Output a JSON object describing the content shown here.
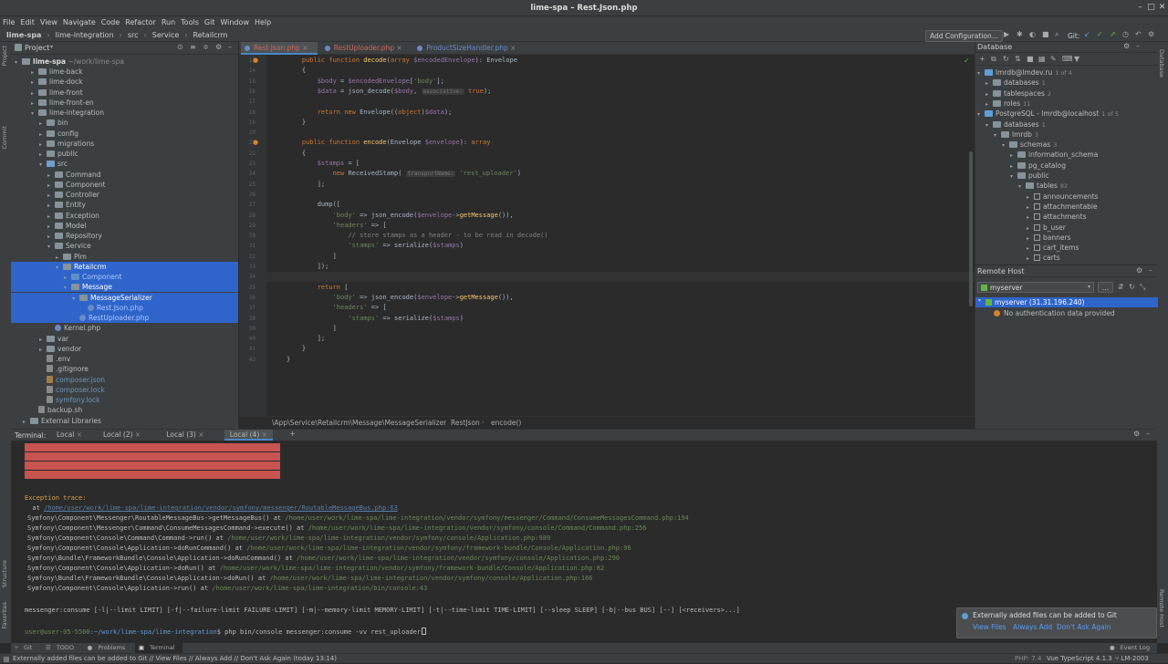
{
  "window": {
    "title": "lime-spa – Rest.Json.php"
  },
  "menu": [
    "File",
    "Edit",
    "View",
    "Navigate",
    "Code",
    "Refactor",
    "Run",
    "Tools",
    "Git",
    "Window",
    "Help"
  ],
  "breadcrumb": [
    "lime-spa",
    "lime-integration",
    "src",
    "Service",
    "Retailcrm"
  ],
  "toolbar": {
    "add_config": "Add Configuration...",
    "git_label": "Git:"
  },
  "side_tabs": {
    "project": "Project",
    "commit": "Commit",
    "structure": "Structure",
    "favorites": "Favorites",
    "database": "Database",
    "remote": "Remote Host"
  },
  "project": {
    "header": "Project",
    "root_name": "lime-spa",
    "root_path": "~/work/lime-spa",
    "items": [
      {
        "label": "lime-back",
        "d": 2,
        "t": "folder"
      },
      {
        "label": "lime-dock",
        "d": 2,
        "t": "folder"
      },
      {
        "label": "lime-front",
        "d": 2,
        "t": "folder"
      },
      {
        "label": "lime-front-en",
        "d": 2,
        "t": "folder"
      },
      {
        "label": "lime-integration",
        "d": 2,
        "t": "folder",
        "open": true
      },
      {
        "label": "bin",
        "d": 3,
        "t": "folder"
      },
      {
        "label": "config",
        "d": 3,
        "t": "folder"
      },
      {
        "label": "migrations",
        "d": 3,
        "t": "folder"
      },
      {
        "label": "public",
        "d": 3,
        "t": "folder"
      },
      {
        "label": "src",
        "d": 3,
        "t": "src",
        "open": true
      },
      {
        "label": "Command",
        "d": 4,
        "t": "folder"
      },
      {
        "label": "Component",
        "d": 4,
        "t": "folder"
      },
      {
        "label": "Controller",
        "d": 4,
        "t": "folder"
      },
      {
        "label": "Entity",
        "d": 4,
        "t": "folder"
      },
      {
        "label": "Exception",
        "d": 4,
        "t": "folder"
      },
      {
        "label": "Model",
        "d": 4,
        "t": "folder"
      },
      {
        "label": "Repository",
        "d": 4,
        "t": "folder"
      },
      {
        "label": "Service",
        "d": 4,
        "t": "folder",
        "open": true
      },
      {
        "label": "Plm",
        "d": 5,
        "t": "folder"
      },
      {
        "label": "Retailcrm",
        "d": 5,
        "t": "folder",
        "open": true,
        "sel": true
      },
      {
        "label": "Component",
        "d": 6,
        "t": "folder",
        "sel": true,
        "blue": true
      },
      {
        "label": "Message",
        "d": 6,
        "t": "folder",
        "open": true,
        "sel": true
      },
      {
        "label": "MessageSerializer",
        "d": 7,
        "t": "folder",
        "open": true,
        "sel": true
      },
      {
        "label": "Rest.Json.php",
        "d": 8,
        "t": "php",
        "sel": true,
        "blue": true
      },
      {
        "label": "RestUploader.php",
        "d": 7,
        "t": "php",
        "sel": true,
        "blue": true
      },
      {
        "label": "Kernel.php",
        "d": 4,
        "t": "php"
      },
      {
        "label": "var",
        "d": 3,
        "t": "folder"
      },
      {
        "label": "vendor",
        "d": 3,
        "t": "folder"
      },
      {
        "label": ".env",
        "d": 3,
        "t": "txt"
      },
      {
        "label": ".gitignore",
        "d": 3,
        "t": "txt"
      },
      {
        "label": "composer.json",
        "d": 3,
        "t": "json",
        "blue": true
      },
      {
        "label": "composer.lock",
        "d": 3,
        "t": "txt",
        "blue": true
      },
      {
        "label": "symfony.lock",
        "d": 3,
        "t": "txt",
        "blue": true
      },
      {
        "label": "backup.sh",
        "d": 2,
        "t": "txt"
      },
      {
        "label": "External Libraries",
        "d": 1,
        "t": "lib"
      }
    ]
  },
  "editor": {
    "tabs": [
      {
        "label": "Rest.Json.php",
        "active": true,
        "color": "#d0695d"
      },
      {
        "label": "RestUploader.php",
        "color": "#d0695d"
      },
      {
        "label": "ProductSizeHandler.php",
        "color": "#6c89c9"
      }
    ],
    "lines": [
      {
        "n": "13",
        "html": "    <span class='kw'>public function</span> <span class='fn'>decode</span>(<span class='kw'>array</span> <span class='var'>$encodedEnvelope</span>): Envelope"
      },
      {
        "n": "14",
        "html": "    {"
      },
      {
        "n": "15",
        "html": "        <span class='var'>$body</span> = <span class='var'>$encodedEnvelope</span>[<span class='str'>'body'</span>];"
      },
      {
        "n": "16",
        "html": "        <span class='var'>$data</span> = json_decode(<span class='var'>$body</span>, <span class='hint'>associative:</span> <span class='kw'>true</span>);"
      },
      {
        "n": "17",
        "html": ""
      },
      {
        "n": "18",
        "html": "        <span class='kw'>return new</span> Envelope((<span class='kw'>object</span>)<span class='var'>$data</span>);"
      },
      {
        "n": "19",
        "html": "    }"
      },
      {
        "n": "20",
        "html": ""
      },
      {
        "n": "21",
        "html": "    <span class='kw'>public function</span> <span class='fn'>encode</span>(Envelope <span class='var'>$envelope</span>): <span class='kw'>array</span>"
      },
      {
        "n": "22",
        "html": "    {"
      },
      {
        "n": "23",
        "html": "        <span class='var'>$stamps</span> = ["
      },
      {
        "n": "24",
        "html": "            <span class='kw'>new</span> ReceivedStamp( <span class='hint'>transportName:</span> <span class='str'>'rest_uploader'</span>)"
      },
      {
        "n": "25",
        "html": "        ];"
      },
      {
        "n": "26",
        "html": ""
      },
      {
        "n": "27",
        "html": "        dump(["
      },
      {
        "n": "28",
        "html": "            <span class='str'>'body'</span> => json_encode(<span class='var'>$envelope</span>-><span class='fn'>getMessage</span>()),"
      },
      {
        "n": "29",
        "html": "            <span class='str'>'headers'</span> => ["
      },
      {
        "n": "30",
        "html": "                <span class='cm'>// store stamps as a header - to be read in decode()</span>"
      },
      {
        "n": "31",
        "html": "                <span class='str'>'stamps'</span> => serialize(<span class='var'>$stamps</span>)"
      },
      {
        "n": "32",
        "html": "            ]"
      },
      {
        "n": "33",
        "html": "        ]);"
      },
      {
        "n": "34",
        "html": ""
      },
      {
        "n": "35",
        "html": "        <span class='kw'>return</span> ["
      },
      {
        "n": "36",
        "html": "            <span class='str'>'body'</span> => json_encode(<span class='var'>$envelope</span>-><span class='fn'>getMessage</span>()),"
      },
      {
        "n": "37",
        "html": "            <span class='str'>'headers'</span> => ["
      },
      {
        "n": "38",
        "html": "                <span class='str'>'stamps'</span> => serialize(<span class='var'>$stamps</span>)"
      },
      {
        "n": "39",
        "html": "            ]"
      },
      {
        "n": "40",
        "html": "        ];"
      },
      {
        "n": "41",
        "html": "    }"
      },
      {
        "n": "42",
        "html": "}"
      }
    ],
    "breadcrumb": [
      "\\App\\Service\\Retailcrm\\Message\\MessageSerializer",
      "RestJson",
      "encode()"
    ]
  },
  "database": {
    "header": "Database",
    "items": [
      {
        "label": "lmrdb@lmdev.ru",
        "count": "1 of 4",
        "d": 0
      },
      {
        "label": "databases",
        "count": "1",
        "d": 1
      },
      {
        "label": "tablespaces",
        "count": "2",
        "d": 1
      },
      {
        "label": "roles",
        "count": "11",
        "d": 1
      },
      {
        "label": "PostgreSQL - lmrdb@localhost",
        "count": "1 of 5",
        "d": 0
      },
      {
        "label": "databases",
        "count": "1",
        "d": 1
      },
      {
        "label": "lmrdb",
        "count": "3",
        "d": 2
      },
      {
        "label": "schemas",
        "count": "3",
        "d": 3
      },
      {
        "label": "information_schema",
        "count": "",
        "d": 4
      },
      {
        "label": "pg_catalog",
        "count": "",
        "d": 4
      },
      {
        "label": "public",
        "count": "",
        "d": 4
      },
      {
        "label": "tables",
        "count": "82",
        "d": 5
      },
      {
        "label": "announcements",
        "count": "",
        "d": 6
      },
      {
        "label": "attachmentable",
        "count": "",
        "d": 6
      },
      {
        "label": "attachments",
        "count": "",
        "d": 6
      },
      {
        "label": "b_user",
        "count": "",
        "d": 6
      },
      {
        "label": "banners",
        "count": "",
        "d": 6
      },
      {
        "label": "cart_items",
        "count": "",
        "d": 6
      },
      {
        "label": "carts",
        "count": "",
        "d": 6
      }
    ]
  },
  "remote": {
    "header": "Remote Host",
    "server_select": "myserver",
    "server": "myserver (31.31.196.240)",
    "message": "No authentication data provided"
  },
  "terminal": {
    "label": "Terminal:",
    "tabs": [
      "Local",
      "Local (2)",
      "Local (3)",
      "Local (4)"
    ],
    "trace_header": "Exception trace:",
    "at_prefix": "  at ",
    "at_link": "/home/user/work/lime-spa/lime-integration/vendor/symfony/messenger/RoutableMessageBus.php:63",
    "trace": [
      {
        "c": "Symfony\\Component\\Messenger\\RoutableMessageBus->getMessageBus() at ",
        "p": "/home/user/work/lime-spa/lime-integration/vendor/symfony/messenger/Command/ConsumeMessagesCommand.php:194"
      },
      {
        "c": "Symfony\\Component\\Messenger\\Command\\ConsumeMessagesCommand->execute() at ",
        "p": "/home/user/work/lime-spa/lime-integration/vendor/symfony/console/Command/Command.php:256"
      },
      {
        "c": "Symfony\\Component\\Console\\Command\\Command->run() at ",
        "p": "/home/user/work/lime-spa/lime-integration/vendor/symfony/console/Application.php:989"
      },
      {
        "c": "Symfony\\Component\\Console\\Application->doRunCommand() at ",
        "p": "/home/user/work/lime-spa/lime-integration/vendor/symfony/framework-bundle/Console/Application.php:96"
      },
      {
        "c": "Symfony\\Bundle\\FrameworkBundle\\Console\\Application->doRunCommand() at ",
        "p": "/home/user/work/lime-spa/lime-integration/vendor/symfony/console/Application.php:290"
      },
      {
        "c": "Symfony\\Component\\Console\\Application->doRun() at ",
        "p": "/home/user/work/lime-spa/lime-integration/vendor/symfony/framework-bundle/Console/Application.php:82"
      },
      {
        "c": "Symfony\\Bundle\\FrameworkBundle\\Console\\Application->doRun() at ",
        "p": "/home/user/work/lime-spa/lime-integration/vendor/symfony/console/Application.php:166"
      },
      {
        "c": "Symfony\\Component\\Console\\Application->run() at ",
        "p": "/home/user/work/lime-spa/lime-integration/bin/console:43"
      }
    ],
    "usage": "messenger:consume [-l|--limit LIMIT] [-f|--failure-limit FAILURE-LIMIT] [-m|--memory-limit MEMORY-LIMIT] [-t|--time-limit TIME-LIMIT] [--sleep SLEEP] [-b|--bus BUS] [--] [<receivers>...]",
    "prompt_user": "user@user-05-5500",
    "prompt_path": ":~/work/lime-spa/lime-integration",
    "command": "$ php bin/console messenger:consume -vv rest_uploader"
  },
  "notification": {
    "text": "Externally added files can be added to Git",
    "actions": [
      "View Files",
      "Always Add",
      "Don't Ask Again"
    ]
  },
  "bottom_tabs": [
    "Git",
    "TODO",
    "Problems",
    "Terminal",
    "Event Log"
  ],
  "status": {
    "message": "Externally added files can be added to Git // View Files // Always Add // Don't Ask Again (today 13:14)",
    "php": "PHP: 7.4",
    "ts": "Vue TypeScript 4.1.3",
    "branch": "LM-2003"
  }
}
